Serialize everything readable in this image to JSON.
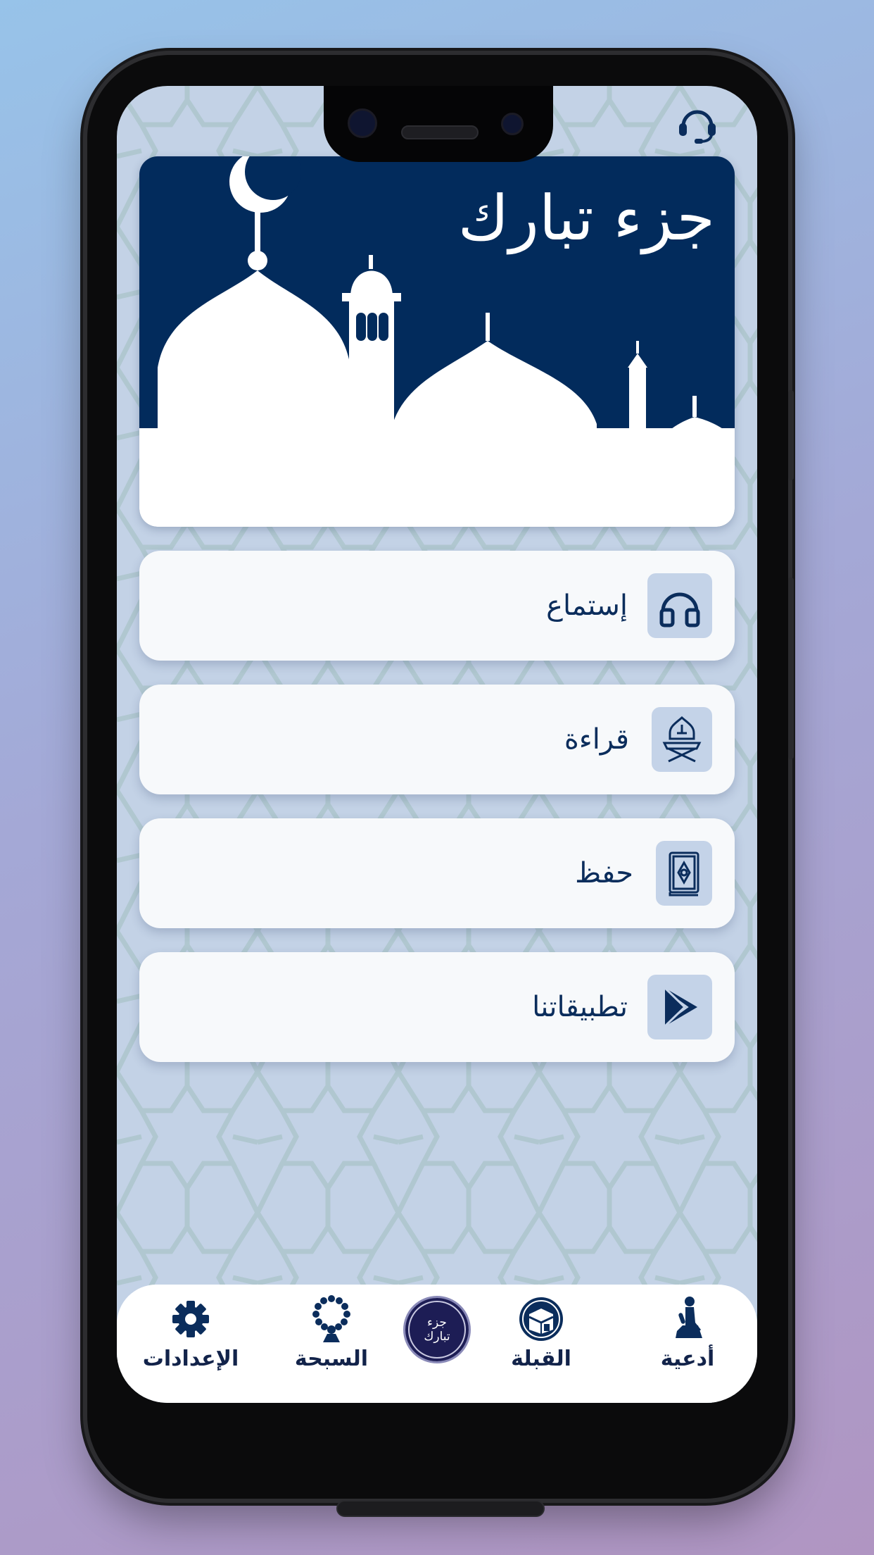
{
  "hero": {
    "title": "جزء تبارك"
  },
  "menu": [
    {
      "label": "إستماع",
      "icon": "headphones-icon"
    },
    {
      "label": "قراءة",
      "icon": "quran-stand-icon"
    },
    {
      "label": "حفظ",
      "icon": "mushaf-book-icon"
    },
    {
      "label": "تطبيقاتنا",
      "icon": "play-store-icon"
    }
  ],
  "nav": {
    "settings": "الإعدادات",
    "tasbih": "السبحة",
    "logo_text": "جزء تبارك",
    "qibla": "القبلة",
    "duas": "أدعية"
  },
  "colors": {
    "navy": "#022b5c",
    "card": "#f7f9fb",
    "icon_bg": "#c4d3e8",
    "screen_bg": "#c3d2e6"
  }
}
